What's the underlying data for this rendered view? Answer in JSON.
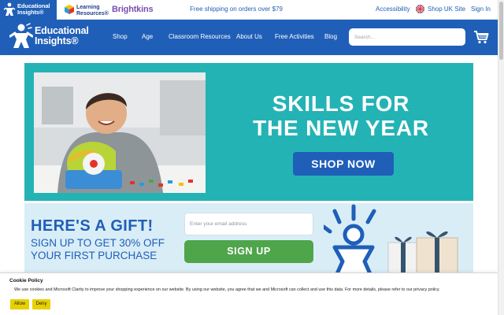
{
  "topbar": {
    "brands": [
      {
        "name": "Educational Insights",
        "line1": "Educational",
        "line2": "Insights®"
      },
      {
        "name": "Learning Resources",
        "line1": "Learning",
        "line2": "Resources®"
      },
      {
        "name": "Brightkins",
        "text": "Brightkins"
      }
    ],
    "promo": "Free shipping on orders over $79",
    "accessibility": "Accessibility",
    "region": "Shop UK Site",
    "sign_in": "Sign In"
  },
  "nav": {
    "logo_line1": "Educational",
    "logo_line2": "Insights®",
    "items": [
      "Shop",
      "Age",
      "Classroom Resources",
      "About Us",
      "Free Activities",
      "Blog"
    ],
    "search_placeholder": "Search..."
  },
  "hero": {
    "title_line1": "SKILLS FOR",
    "title_line2": "THE NEW YEAR",
    "cta": "SHOP NOW",
    "background": "#24b3b5",
    "button_color": "#1f5fb8"
  },
  "signup": {
    "title": "HERE'S A GIFT!",
    "sub_line1": "SIGN UP TO GET 30% OFF",
    "sub_line2": "YOUR FIRST PURCHASE",
    "email_placeholder": "Enter your email address",
    "cta": "SIGN UP",
    "background": "#d9edf7",
    "button_color": "#4ea54a"
  },
  "cookie": {
    "title": "Cookie Policy",
    "text": "We use cookies and Microsoft Clarity to improve your shopping experience on our website. By using our website, you agree that we and Microsoft can collect and use this data. For more details, please refer to our privacy policy.",
    "allow": "Allow",
    "deny": "Deny",
    "button_color": "#e8d100"
  },
  "colors": {
    "brand_blue": "#1f5fb8"
  }
}
